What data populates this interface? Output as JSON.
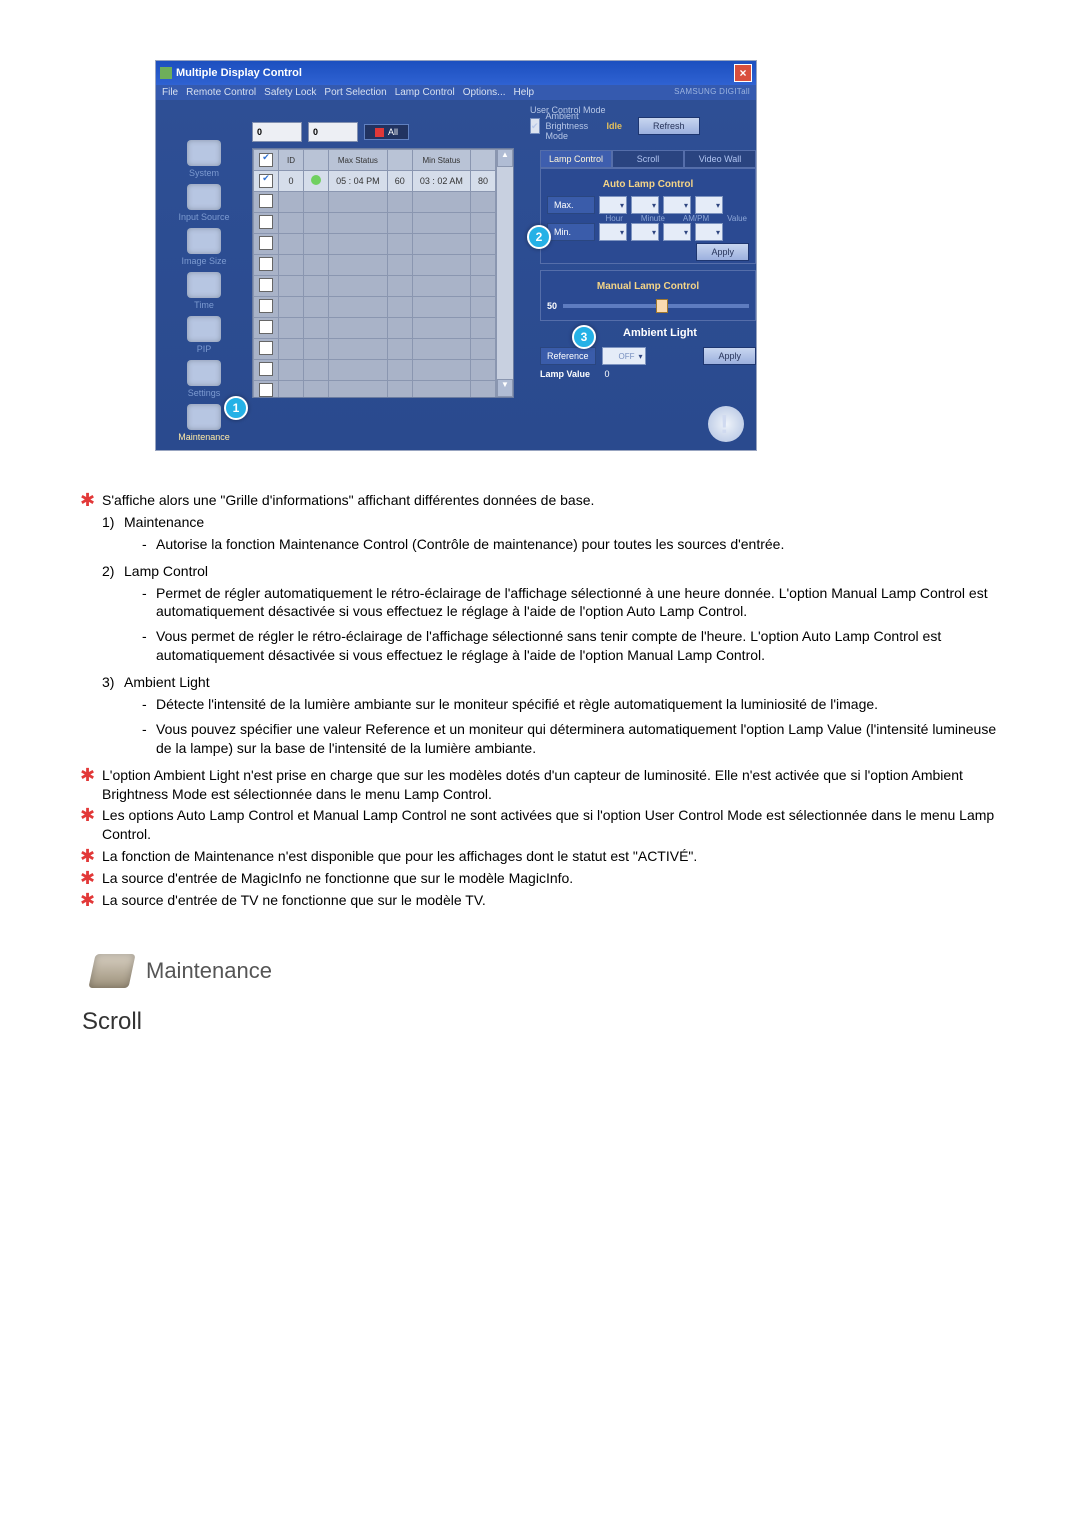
{
  "app": {
    "title": "Multiple Display Control",
    "brand": "SAMSUNG DIGITall",
    "menus": [
      "File",
      "Remote Control",
      "Safety Lock",
      "Port Selection",
      "Lamp Control",
      "Options...",
      "Help"
    ]
  },
  "sidebar": {
    "items": [
      {
        "label": "System"
      },
      {
        "label": "Input Source"
      },
      {
        "label": "Image Size"
      },
      {
        "label": "Time"
      },
      {
        "label": "PIP"
      },
      {
        "label": "Settings"
      },
      {
        "label": "Maintenance",
        "selected": true
      }
    ]
  },
  "top": {
    "spin1": "0",
    "spin2": "0",
    "all": "All",
    "ucm": "User Control Mode",
    "abm": "Ambient Brightness Mode",
    "idle": "Idle",
    "refresh": "Refresh"
  },
  "grid": {
    "headers": [
      "",
      "ID",
      "",
      "Max Status",
      "",
      "Min Status",
      ""
    ],
    "row": {
      "id": "0",
      "max": "05 : 04 PM",
      "maxv": "60",
      "min": "03 : 02 AM",
      "minv": "80"
    }
  },
  "tabs": {
    "lamp": "Lamp Control",
    "scroll": "Scroll",
    "vw": "Video Wall"
  },
  "auto": {
    "title": "Auto Lamp Control",
    "max": "Max.",
    "min": "Min.",
    "cols": {
      "hour": "Hour",
      "minute": "Minute",
      "ampm": "AM/PM",
      "value": "Value"
    },
    "apply": "Apply"
  },
  "manual": {
    "title": "Manual Lamp Control",
    "value": "50"
  },
  "ambient": {
    "title": "Ambient Light",
    "reference": "Reference",
    "off": "OFF",
    "apply": "Apply",
    "lampvalue_label": "Lamp Value",
    "lampvalue": "0"
  },
  "callouts": {
    "c1": "1",
    "c2": "2",
    "c3": "3"
  },
  "doc": {
    "b1": "S'affiche alors une \"Grille d'informations\" affichant différentes données de base.",
    "n1": "Maintenance",
    "d1": "Autorise la fonction Maintenance Control (Contrôle de maintenance) pour toutes les sources d'entrée.",
    "n2": "Lamp Control",
    "d2a": "Permet de régler automatiquement le rétro-éclairage de l'affichage sélectionné à une heure donnée. L'option Manual Lamp Control est automatiquement désactivée si vous effectuez le réglage à l'aide de l'option Auto Lamp Control.",
    "d2b": "Vous permet de régler le rétro-éclairage de l'affichage sélectionné sans tenir compte de l'heure. L'option Auto Lamp Control est automatiquement désactivée si vous effectuez le réglage à l'aide de l'option Manual Lamp Control.",
    "n3": "Ambient Light",
    "d3a": "Détecte l'intensité de la lumière ambiante sur le moniteur spécifié et règle automatiquement la luminiosité de l'image.",
    "d3b": "Vous pouvez spécifier une valeur Reference et un moniteur qui déterminera automatiquement l'option Lamp Value (l'intensité lumineuse de la lampe) sur la base de l'intensité de la lumière ambiante.",
    "b2": "L'option Ambient Light n'est prise en charge que sur les modèles dotés d'un capteur de luminosité. Elle n'est activée que si l'option Ambient Brightness Mode est sélectionnée dans le menu Lamp Control.",
    "b3": "Les options Auto Lamp Control et Manual Lamp Control ne sont activées que si l'option User Control Mode est sélectionnée dans le menu Lamp Control.",
    "b4": "La fonction de Maintenance n'est disponible que pour les affichages dont le statut est \"ACTIVÉ\".",
    "b5": "La source d'entrée de MagicInfo ne fonctionne que sur le modèle MagicInfo.",
    "b6": "La source d'entrée de TV ne fonctionne que sur le modèle TV."
  },
  "section": {
    "heading": "Maintenance",
    "sub": "Scroll"
  }
}
